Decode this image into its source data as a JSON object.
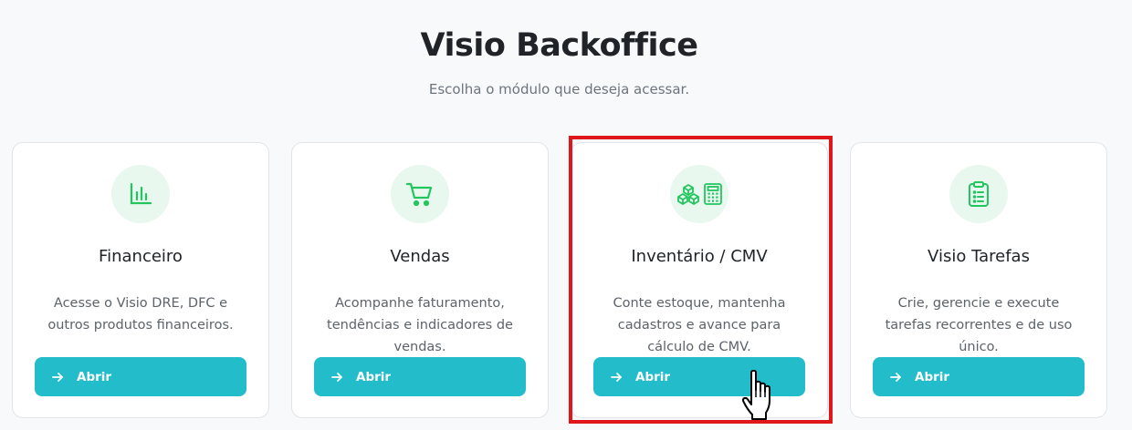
{
  "header": {
    "title": "Visio Backoffice",
    "subtitle": "Escolha o módulo que deseja acessar."
  },
  "cards": [
    {
      "title": "Financeiro",
      "description": "Acesse o Visio DRE, DFC e outros produtos financeiros.",
      "button_label": "Abrir",
      "icon": "bar-chart-icon"
    },
    {
      "title": "Vendas",
      "description": "Acompanhe faturamento, tendências e indicadores de vendas.",
      "button_label": "Abrir",
      "icon": "shopping-cart-icon"
    },
    {
      "title": "Inventário / CMV",
      "description": "Conte estoque, mantenha cadastros e avance para cálculo de CMV.",
      "button_label": "Abrir",
      "icon": "boxes-calculator-icon"
    },
    {
      "title": "Visio Tarefas",
      "description": "Crie, gerencie e execute tarefas recorrentes e de uso único.",
      "button_label": "Abrir",
      "icon": "clipboard-list-icon"
    }
  ],
  "colors": {
    "accent": "#22bccb",
    "icon_green": "#22c55e",
    "icon_bg": "#e8f8ef",
    "highlight": "#e0161d"
  }
}
